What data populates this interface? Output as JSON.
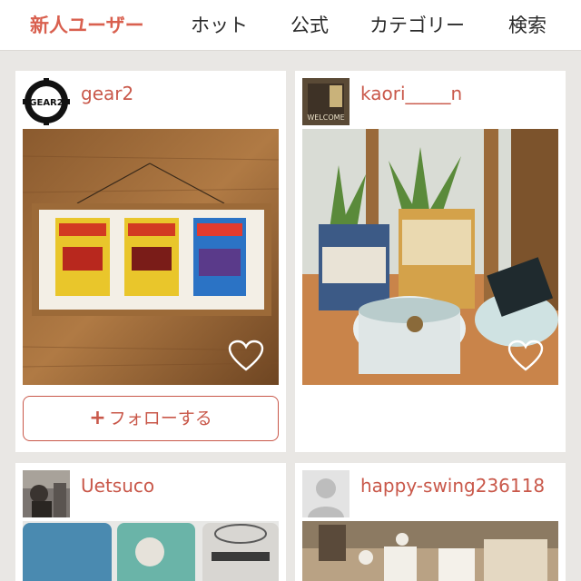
{
  "nav": {
    "tabs": [
      {
        "label": "新人ユーザー",
        "active": true
      },
      {
        "label": "ホット"
      },
      {
        "label": "公式"
      },
      {
        "label": "カテゴリー"
      },
      {
        "label": "検索"
      }
    ]
  },
  "colors": {
    "accent": "#c9584a",
    "active_tab": "#d9604f",
    "background": "#e9e7e4"
  },
  "posts": [
    {
      "username": "gear2",
      "avatar_text": "GEAR2",
      "follow_label": "フォローする",
      "follow_icon": "plus-icon"
    },
    {
      "username": "kaori_____n",
      "avatar_text": "WELCOME"
    },
    {
      "username": "Uetsuco"
    },
    {
      "username": "happy-swing236118"
    }
  ]
}
